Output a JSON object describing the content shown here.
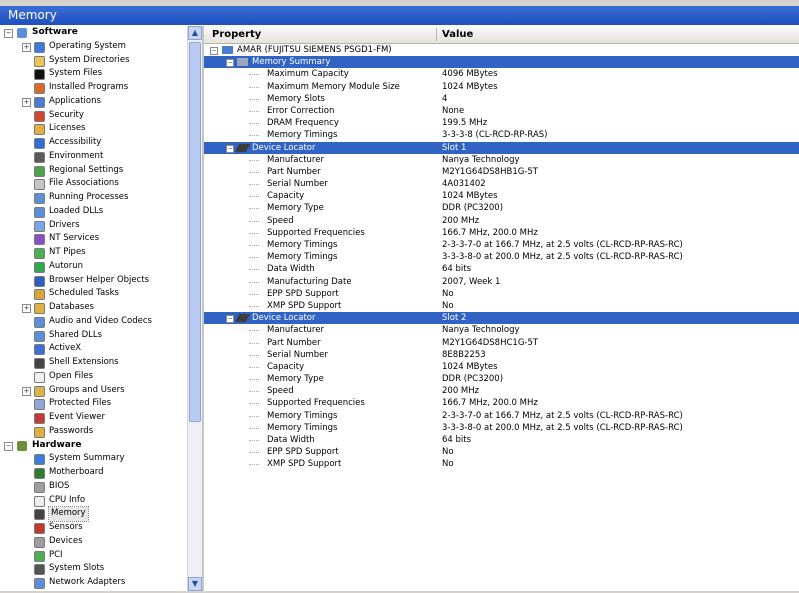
{
  "window": {
    "title": "Memory"
  },
  "tree": {
    "software_label": "Software",
    "software_items": [
      {
        "label": "Operating System",
        "icon": "os-icon",
        "color": "#3d7bd9",
        "exp": true
      },
      {
        "label": "System Directories",
        "icon": "folder-icon",
        "color": "#e8c45a",
        "exp": false
      },
      {
        "label": "System Files",
        "icon": "cmd-icon",
        "color": "#111111",
        "exp": false
      },
      {
        "label": "Installed Programs",
        "icon": "installer-icon",
        "color": "#d86b2b",
        "exp": false
      },
      {
        "label": "Applications",
        "icon": "applications-icon",
        "color": "#4a7ccf",
        "exp": true
      },
      {
        "label": "Security",
        "icon": "security-icon",
        "color": "#d2462f",
        "exp": false
      },
      {
        "label": "Licenses",
        "icon": "licenses-icon",
        "color": "#e0b040",
        "exp": false
      },
      {
        "label": "Accessibility",
        "icon": "accessibility-icon",
        "color": "#2d6fd1",
        "exp": false
      },
      {
        "label": "Environment",
        "icon": "environment-icon",
        "color": "#5a5a5a",
        "exp": false
      },
      {
        "label": "Regional Settings",
        "icon": "globe-icon",
        "color": "#4aa34a",
        "exp": false
      },
      {
        "label": "File Associations",
        "icon": "file-assoc-icon",
        "color": "#c6c6c6",
        "exp": false
      },
      {
        "label": "Running Processes",
        "icon": "process-icon",
        "color": "#5b8fd9",
        "exp": false
      },
      {
        "label": "Loaded DLLs",
        "icon": "dll-icon",
        "color": "#5b8fd9",
        "exp": false
      },
      {
        "label": "Drivers",
        "icon": "drivers-icon",
        "color": "#7aa7e8",
        "exp": false
      },
      {
        "label": "NT Services",
        "icon": "services-icon",
        "color": "#8a4fc7",
        "exp": false
      },
      {
        "label": "NT Pipes",
        "icon": "pipes-icon",
        "color": "#4caf50",
        "exp": false
      },
      {
        "label": "Autorun",
        "icon": "autorun-icon",
        "color": "#2fa84f",
        "exp": false
      },
      {
        "label": "Browser Helper Objects",
        "icon": "bho-icon",
        "color": "#2d5fc0",
        "exp": false
      },
      {
        "label": "Scheduled Tasks",
        "icon": "tasks-icon",
        "color": "#d8a53a",
        "exp": false
      },
      {
        "label": "Databases",
        "icon": "databases-icon",
        "color": "#e0b040",
        "exp": true
      },
      {
        "label": "Audio and Video Codecs",
        "icon": "codecs-icon",
        "color": "#5b8fd9",
        "exp": false
      },
      {
        "label": "Shared DLLs",
        "icon": "shared-dll-icon",
        "color": "#5b8fd9",
        "exp": false
      },
      {
        "label": "ActiveX",
        "icon": "activex-icon",
        "color": "#3b6fd1",
        "exp": false
      },
      {
        "label": "Shell Extensions",
        "icon": "shell-ext-icon",
        "color": "#444444",
        "exp": false
      },
      {
        "label": "Open Files",
        "icon": "open-files-icon",
        "color": "#f0f0f0",
        "exp": false
      },
      {
        "label": "Groups and Users",
        "icon": "users-icon",
        "color": "#d7b54a",
        "exp": true
      },
      {
        "label": "Protected Files",
        "icon": "protected-files-icon",
        "color": "#8fa8d8",
        "exp": false
      },
      {
        "label": "Event Viewer",
        "icon": "event-viewer-icon",
        "color": "#c23b3b",
        "exp": false
      },
      {
        "label": "Passwords",
        "icon": "key-icon",
        "color": "#e0b040",
        "exp": false
      }
    ],
    "hardware_label": "Hardware",
    "hardware_items": [
      {
        "label": "System Summary",
        "icon": "system-summary-icon",
        "color": "#3d7bd9"
      },
      {
        "label": "Motherboard",
        "icon": "motherboard-icon",
        "color": "#2e7d32"
      },
      {
        "label": "BIOS",
        "icon": "bios-icon",
        "color": "#9e9e9e"
      },
      {
        "label": "CPU Info",
        "icon": "cpu-icon",
        "color": "#eeeeee"
      },
      {
        "label": "Memory",
        "icon": "memory-icon",
        "color": "#444444",
        "selected": true
      },
      {
        "label": "Sensors",
        "icon": "sensors-icon",
        "color": "#c0392b"
      },
      {
        "label": "Devices",
        "icon": "devices-icon",
        "color": "#9e9e9e"
      },
      {
        "label": "PCI",
        "icon": "pci-icon",
        "color": "#4caf50"
      },
      {
        "label": "System Slots",
        "icon": "slots-icon",
        "color": "#555555"
      },
      {
        "label": "Network Adapters",
        "icon": "network-icon",
        "color": "#5b8fd9"
      }
    ]
  },
  "columns": {
    "property": "Property",
    "value": "Value"
  },
  "root_node": "AMAR (FUJITSU SIEMENS PSGD1-FM)",
  "memory_summary": {
    "header": "Memory Summary",
    "rows": [
      {
        "p": "Maximum Capacity",
        "v": "4096 MBytes"
      },
      {
        "p": "Maximum Memory Module Size",
        "v": "1024 MBytes"
      },
      {
        "p": "Memory Slots",
        "v": "4"
      },
      {
        "p": "Error Correction",
        "v": "None"
      },
      {
        "p": "DRAM Frequency",
        "v": "199.5 MHz"
      },
      {
        "p": "Memory Timings",
        "v": "3-3-3-8 (CL-RCD-RP-RAS)"
      }
    ]
  },
  "device_locators": [
    {
      "header": "Device Locator",
      "slot": "Slot 1",
      "rows": [
        {
          "p": "Manufacturer",
          "v": "Nanya Technology"
        },
        {
          "p": "Part Number",
          "v": "M2Y1G64DS8HB1G-5T"
        },
        {
          "p": "Serial Number",
          "v": "4A031402"
        },
        {
          "p": "Capacity",
          "v": "1024 MBytes"
        },
        {
          "p": "Memory Type",
          "v": "DDR (PC3200)"
        },
        {
          "p": "Speed",
          "v": "200 MHz"
        },
        {
          "p": "Supported Frequencies",
          "v": "166.7 MHz, 200.0 MHz"
        },
        {
          "p": "Memory Timings",
          "v": "2-3-3-7-0 at 166.7 MHz, at 2.5 volts (CL-RCD-RP-RAS-RC)"
        },
        {
          "p": "Memory Timings",
          "v": "3-3-3-8-0 at 200.0 MHz, at 2.5 volts (CL-RCD-RP-RAS-RC)"
        },
        {
          "p": "Data Width",
          "v": "64 bits"
        },
        {
          "p": "Manufacturing Date",
          "v": "2007, Week 1"
        },
        {
          "p": "EPP SPD Support",
          "v": "No"
        },
        {
          "p": "XMP SPD Support",
          "v": "No"
        }
      ]
    },
    {
      "header": "Device Locator",
      "slot": "Slot 2",
      "rows": [
        {
          "p": "Manufacturer",
          "v": "Nanya Technology"
        },
        {
          "p": "Part Number",
          "v": "M2Y1G64DS8HC1G-5T"
        },
        {
          "p": "Serial Number",
          "v": "8E8B2253"
        },
        {
          "p": "Capacity",
          "v": "1024 MBytes"
        },
        {
          "p": "Memory Type",
          "v": "DDR (PC3200)"
        },
        {
          "p": "Speed",
          "v": "200 MHz"
        },
        {
          "p": "Supported Frequencies",
          "v": "166.7 MHz, 200.0 MHz"
        },
        {
          "p": "Memory Timings",
          "v": "2-3-3-7-0 at 166.7 MHz, at 2.5 volts (CL-RCD-RP-RAS-RC)"
        },
        {
          "p": "Memory Timings",
          "v": "3-3-3-8-0 at 200.0 MHz, at 2.5 volts (CL-RCD-RP-RAS-RC)"
        },
        {
          "p": "Data Width",
          "v": "64 bits"
        },
        {
          "p": "EPP SPD Support",
          "v": "No"
        },
        {
          "p": "XMP SPD Support",
          "v": "No"
        }
      ]
    }
  ]
}
